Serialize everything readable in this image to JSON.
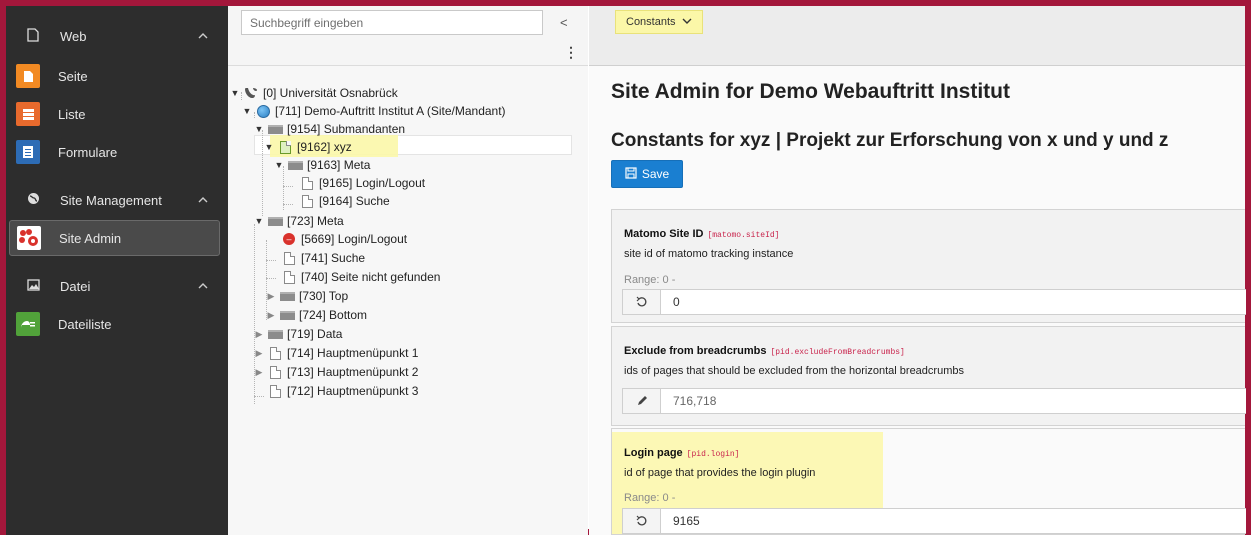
{
  "module_menu": {
    "groups": [
      {
        "label": "Web",
        "icon": "page-icon"
      },
      {
        "label": "Site Management",
        "icon": "globe-icon"
      },
      {
        "label": "Datei",
        "icon": "image-icon"
      }
    ],
    "items": [
      {
        "label": "Seite",
        "icon": "page-module-icon",
        "color": "#f28a23"
      },
      {
        "label": "Liste",
        "icon": "list-module-icon",
        "color": "#e86a2d"
      },
      {
        "label": "Formulare",
        "icon": "form-module-icon",
        "color": "#2d6cb5"
      },
      {
        "label": "Site Admin",
        "icon": "site-admin-icon",
        "color": "#d9322c"
      },
      {
        "label": "Dateiliste",
        "icon": "filelist-module-icon",
        "color": "#51a23a"
      }
    ]
  },
  "tree": {
    "search_placeholder": "Suchbegriff eingeben",
    "collapse_glyph": "<",
    "menu_glyph": "⋮",
    "nodes": [
      {
        "label": "[0] Universität Osnabrück"
      },
      {
        "label": "[711] Demo-Auftritt Institut A (Site/Mandant)"
      },
      {
        "label": "[9154] Submandanten"
      },
      {
        "label": "[9162] xyz"
      },
      {
        "label": "[9163] Meta"
      },
      {
        "label": "[9165] Login/Logout"
      },
      {
        "label": "[9164] Suche"
      },
      {
        "label": "[723] Meta"
      },
      {
        "label": "[5669] Login/Logout"
      },
      {
        "label": "[741] Suche"
      },
      {
        "label": "[740] Seite nicht gefunden"
      },
      {
        "label": "[730] Top"
      },
      {
        "label": "[724] Bottom"
      },
      {
        "label": "[719] Data"
      },
      {
        "label": "[714] Hauptmenüpunkt 1"
      },
      {
        "label": "[713] Hauptmenüpunkt 2"
      },
      {
        "label": "[712] Hauptmenüpunkt 3"
      }
    ]
  },
  "docheader": {
    "dropdown_label": "Constants",
    "dropdown_glyph": "∨"
  },
  "content": {
    "site_title": "Site Admin for Demo Webauftritt Institut",
    "constants_prefix": "Constants for ",
    "constants_page": "xyz | Projekt zur Erforschung von x und y und z",
    "save_label": "Save",
    "fields": [
      {
        "title": "Matomo Site ID",
        "key": "[matomo.siteId]",
        "description": "site id of matomo tracking instance",
        "range": "Range: 0 -",
        "button_icon": "reset-icon",
        "value": "0"
      },
      {
        "title": "Exclude from breadcrumbs",
        "key": "[pid.excludeFromBreadcrumbs]",
        "description": "ids of pages that should be excluded from the horizontal breadcrumbs",
        "button_icon": "pencil-icon",
        "value": "716,718"
      },
      {
        "title": "Login page",
        "key": "[pid.login]",
        "description": "id of page that provides the login plugin",
        "range": "Range: 0 -",
        "button_icon": "reset-icon",
        "value": "9165"
      }
    ]
  },
  "colors": {
    "frame": "#a3173b",
    "highlight": "#fbf7a8",
    "primary": "#1a7fd1",
    "sidebar_bg": "#2d2d2d"
  }
}
